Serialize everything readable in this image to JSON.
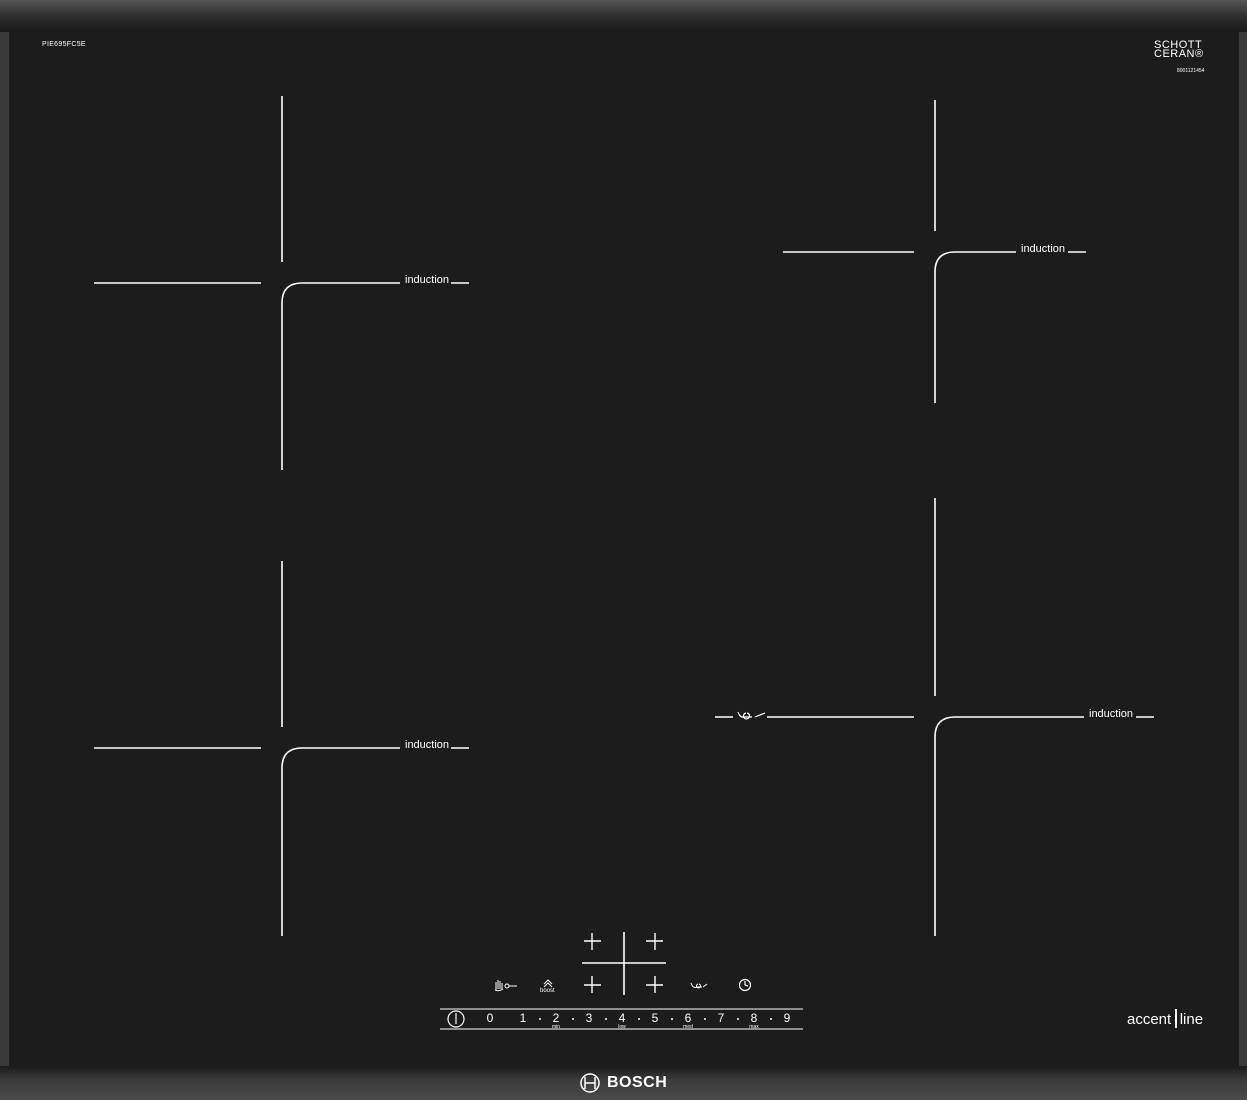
{
  "model_code": "PIE695FC5E",
  "glass_brand": {
    "line1": "SCHOTT",
    "line2": "CERAN®"
  },
  "serial_code": "8001121454",
  "zone_label": "induction",
  "zones": [
    {
      "id": "front-left",
      "label": "induction"
    },
    {
      "id": "rear-left",
      "label": "induction"
    },
    {
      "id": "rear-right",
      "label": "induction"
    },
    {
      "id": "front-right",
      "label": "induction"
    }
  ],
  "controls": {
    "boost_label": "boost",
    "power_levels": [
      "0",
      "1",
      "2",
      "3",
      "4",
      "5",
      "6",
      "7",
      "8",
      "9"
    ],
    "level_sublabels": {
      "2": "min",
      "4": "low",
      "6": "med",
      "8": "max"
    },
    "icons": [
      "power-icon",
      "child-lock-icon",
      "boost-icon",
      "zone-selector-icon",
      "pan-fry-sensor-icon",
      "timer-icon"
    ]
  },
  "series_badge": {
    "part1": "accent",
    "part2": "line"
  },
  "brand": "BOSCH",
  "colors": {
    "glass": "#1c1c1c",
    "frame": "#3a3a3a",
    "line": "#ffffff"
  }
}
